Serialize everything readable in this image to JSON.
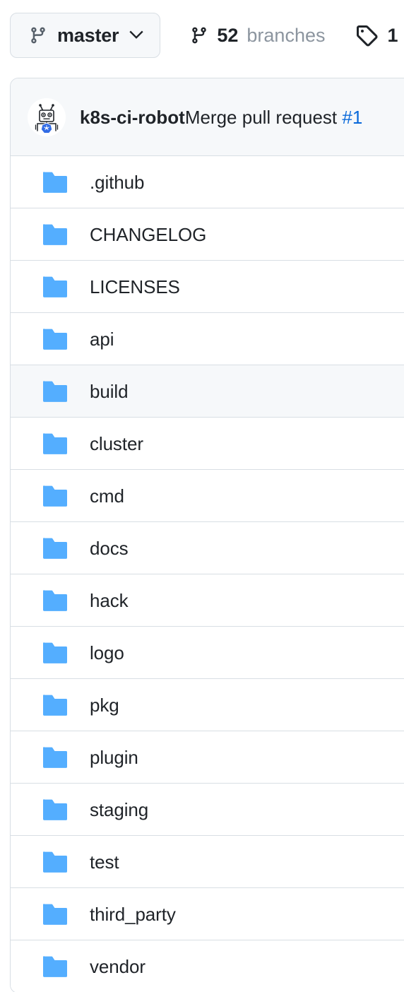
{
  "toolbar": {
    "branch_selector": {
      "label": "master",
      "icon": "git-branch-icon",
      "chevron": "chevron-down-icon"
    },
    "branches": {
      "icon": "git-branch-icon",
      "count": "52",
      "label": "branches"
    },
    "tags": {
      "icon": "tag-icon",
      "count": "1"
    }
  },
  "commit_header": {
    "avatar": "k8s-ci-robot-avatar",
    "author": "k8s-ci-robot",
    "message": "Merge pull request ",
    "pr_link": "#1"
  },
  "files": {
    "columns": [
      "name"
    ],
    "rows": [
      {
        "name": ".github",
        "type": "folder",
        "hovered": false
      },
      {
        "name": "CHANGELOG",
        "type": "folder",
        "hovered": false
      },
      {
        "name": "LICENSES",
        "type": "folder",
        "hovered": false
      },
      {
        "name": "api",
        "type": "folder",
        "hovered": false
      },
      {
        "name": "build",
        "type": "folder",
        "hovered": true
      },
      {
        "name": "cluster",
        "type": "folder",
        "hovered": false
      },
      {
        "name": "cmd",
        "type": "folder",
        "hovered": false
      },
      {
        "name": "docs",
        "type": "folder",
        "hovered": false
      },
      {
        "name": "hack",
        "type": "folder",
        "hovered": false
      },
      {
        "name": "logo",
        "type": "folder",
        "hovered": false
      },
      {
        "name": "pkg",
        "type": "folder",
        "hovered": false
      },
      {
        "name": "plugin",
        "type": "folder",
        "hovered": false
      },
      {
        "name": "staging",
        "type": "folder",
        "hovered": false
      },
      {
        "name": "test",
        "type": "folder",
        "hovered": false
      },
      {
        "name": "third_party",
        "type": "folder",
        "hovered": false
      },
      {
        "name": "vendor",
        "type": "folder",
        "hovered": false
      }
    ]
  },
  "colors": {
    "folder_blue": "#54aeff",
    "link_blue": "#0969da",
    "text": "#1f2328",
    "muted_text": "#8c959f",
    "border": "#d8dee4",
    "surface": "#f6f8fa"
  }
}
